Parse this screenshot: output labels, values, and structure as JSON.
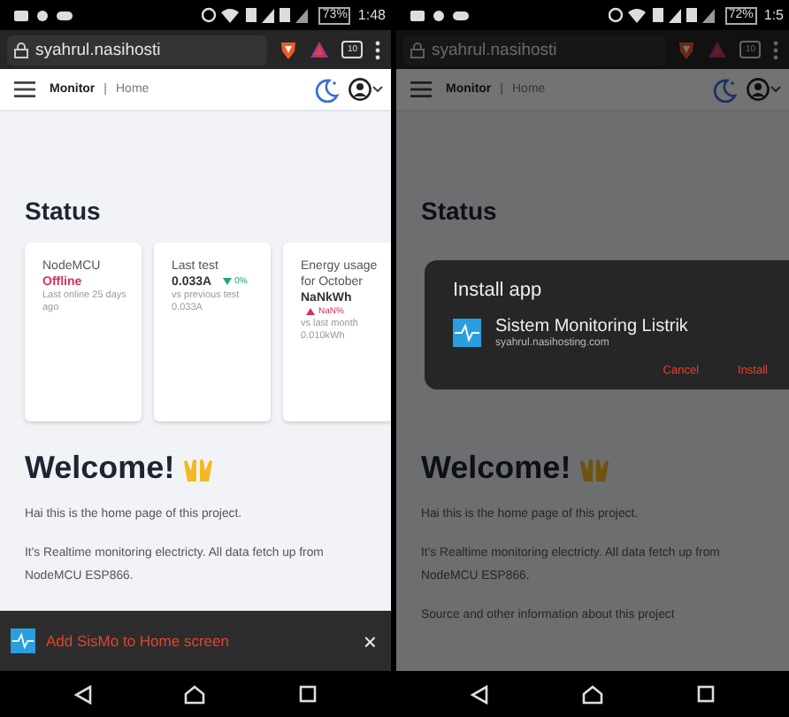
{
  "screens": [
    {
      "status_bar": {
        "battery": "73%",
        "time": "1:48"
      },
      "browser": {
        "url": "syahrul.nasihosti",
        "tab_count": "10"
      },
      "header": {
        "title": "Monitor",
        "separator": "|",
        "crumb": "Home"
      },
      "section_title": "Status",
      "cards": [
        {
          "title": "NodeMCU",
          "value": "Offline",
          "kind": "status",
          "note": "Last online 25 days ago"
        },
        {
          "title": "Last test",
          "value": "0.033A",
          "kind": "metric",
          "rising": false,
          "change": "0%",
          "note": "vs previous test 0.033A"
        },
        {
          "title": "Energy usage for October",
          "value": "NaNkWh",
          "kind": "metric",
          "rising": true,
          "change": "NaN%",
          "note": "vs last month 0.010kWh"
        }
      ],
      "welcome": "Welcome!",
      "paragraphs": [
        "Hai this is the home page of this project.",
        "It's Realtime monitoring electricty. All data fetch up from NodeMCU ESP866."
      ],
      "banner": {
        "text": "Add SisMo to Home screen",
        "close": "×"
      },
      "dimmed": false
    },
    {
      "status_bar": {
        "battery": "72%",
        "time": "1:5"
      },
      "browser": {
        "url": "syahrul.nasihosti",
        "tab_count": "10"
      },
      "header": {
        "title": "Monitor",
        "separator": "|",
        "crumb": "Home"
      },
      "section_title": "Status",
      "welcome": "Welcome!",
      "paragraphs": [
        "Hai this is the home page of this project.",
        "It's Realtime monitoring electricty. All data fetch up from NodeMCU ESP866.",
        "Source and other information about this project"
      ],
      "dialog": {
        "title": "Install app",
        "app_name": "Sistem Monitoring Listrik",
        "app_url": "syahrul.nasihosting.com",
        "buttons": [
          "Cancel",
          "Install"
        ]
      },
      "dimmed": true
    }
  ]
}
